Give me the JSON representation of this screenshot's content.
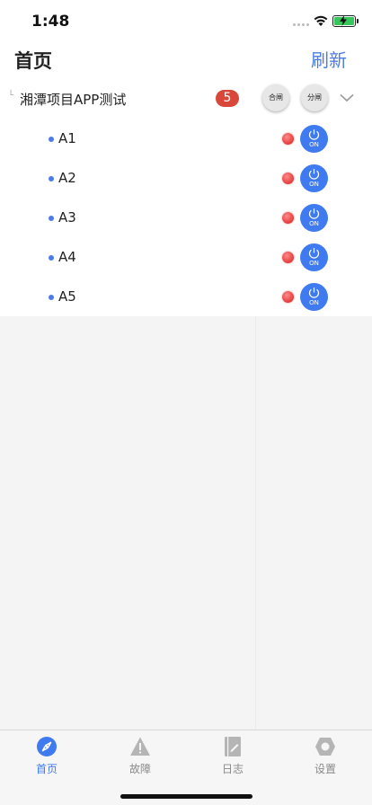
{
  "status_bar": {
    "time": "1:48"
  },
  "header": {
    "title": "首页",
    "refresh_label": "刷新"
  },
  "device_group": {
    "title": "湘潭项目APP测试",
    "count": "5",
    "close_all_label": "合闸",
    "open_all_label": "分闸",
    "devices": [
      {
        "name": "A1",
        "power_label": "ON"
      },
      {
        "name": "A2",
        "power_label": "ON"
      },
      {
        "name": "A3",
        "power_label": "ON"
      },
      {
        "name": "A4",
        "power_label": "ON"
      },
      {
        "name": "A5",
        "power_label": "ON"
      }
    ]
  },
  "tabs": [
    {
      "label": "首页",
      "icon": "compass-icon",
      "active": true
    },
    {
      "label": "故障",
      "icon": "warning-icon",
      "active": false
    },
    {
      "label": "日志",
      "icon": "notebook-icon",
      "active": false
    },
    {
      "label": "设置",
      "icon": "gear-icon",
      "active": false
    }
  ],
  "colors": {
    "accent": "#3f7af0",
    "badge": "#d9463a",
    "status_light": "#e33b3b"
  }
}
